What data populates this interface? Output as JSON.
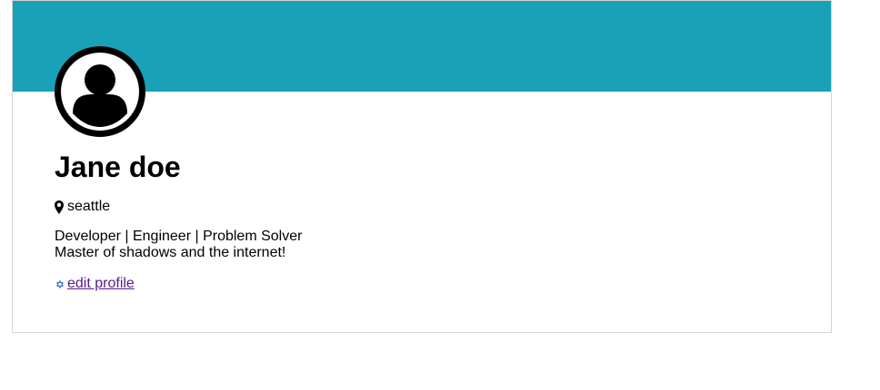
{
  "profile": {
    "name": "Jane doe",
    "location": "seattle",
    "bio_line1": "Developer | Engineer | Problem Solver",
    "bio_line2": "Master of shadows and the internet!",
    "edit_label": " edit profile"
  },
  "icons": {
    "avatar": "user-avatar-icon",
    "location": "map-marker-icon",
    "edit": "gear-icon"
  },
  "colors": {
    "banner": "#18a1b7",
    "link": "#551a8b",
    "gear": "#3b82c4"
  }
}
